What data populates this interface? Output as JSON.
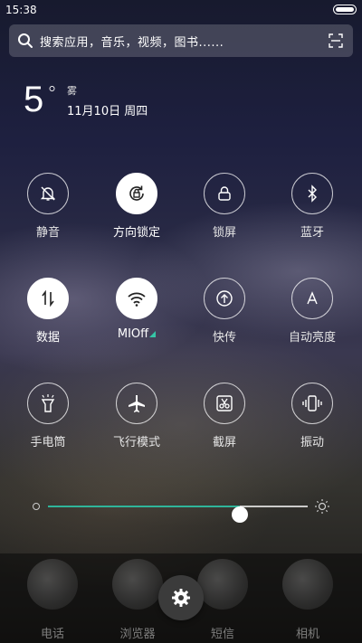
{
  "status_bar": {
    "time": "15:38",
    "battery_icon": "battery-icon"
  },
  "search": {
    "placeholder": "搜索应用，音乐，视频，图书......",
    "icon": "search-icon",
    "scan_icon": "scan-icon"
  },
  "weather": {
    "temperature": "5",
    "degree_symbol": "°",
    "condition": "雾",
    "date": "11月10日 周四"
  },
  "toggles": [
    {
      "label": "静音",
      "icon": "silent-bell-icon",
      "active": false
    },
    {
      "label": "方向锁定",
      "icon": "rotation-lock-icon",
      "active": true
    },
    {
      "label": "锁屏",
      "icon": "lock-icon",
      "active": false
    },
    {
      "label": "蓝牙",
      "icon": "bluetooth-icon",
      "active": false
    },
    {
      "label": "数据",
      "icon": "mobile-data-icon",
      "active": true
    },
    {
      "label": "MIOff",
      "icon": "wifi-icon",
      "active": true
    },
    {
      "label": "快传",
      "icon": "quick-transfer-icon",
      "active": false
    },
    {
      "label": "自动亮度",
      "icon": "auto-brightness-icon",
      "active": false
    },
    {
      "label": "手电筒",
      "icon": "flashlight-icon",
      "active": false
    },
    {
      "label": "飞行模式",
      "icon": "airplane-icon",
      "active": false
    },
    {
      "label": "截屏",
      "icon": "screenshot-icon",
      "active": false
    },
    {
      "label": "振动",
      "icon": "vibrate-icon",
      "active": false
    }
  ],
  "brightness": {
    "level": 0.74
  },
  "dock": [
    {
      "label": "电话",
      "icon": "phone-app-icon"
    },
    {
      "label": "浏览器",
      "icon": "browser-app-icon"
    },
    {
      "label": "短信",
      "icon": "messages-app-icon"
    },
    {
      "label": "相机",
      "icon": "camera-app-icon"
    }
  ],
  "colors": {
    "accent": "#2fb59a"
  },
  "settings_icon": "settings-gear-icon"
}
